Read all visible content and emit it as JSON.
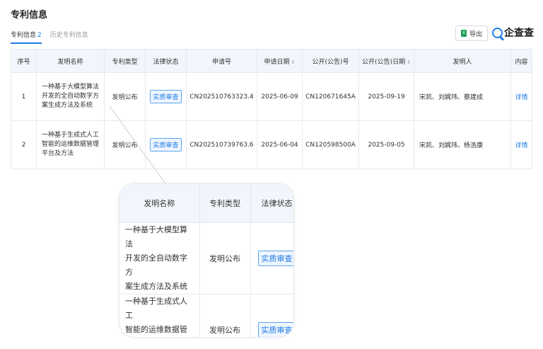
{
  "section_title": "专利信息",
  "tabs": [
    {
      "label": "专利信息",
      "count": "2",
      "active": true
    },
    {
      "label": "历史专利信息",
      "count": "",
      "active": false
    }
  ],
  "toolbar": {
    "export_label": "导出",
    "excel_icon": "excel-icon",
    "brand": "企查查"
  },
  "table": {
    "headers": {
      "index": "序号",
      "name": "发明名称",
      "type": "专利类型",
      "status": "法律状态",
      "app_no": "申请号",
      "app_date": "申请日期",
      "pub_no": "公开(公告)号",
      "pub_date": "公开(公告)日期",
      "inventors": "发明人",
      "content": "内容"
    },
    "sort_glyph": "⇕",
    "rows": [
      {
        "index": "1",
        "name": "一种基于大模型算法开发的全自动数字方案生成方法及系统",
        "name_lines": [
          "一种基于大模型算法",
          "开发的全自动数字方",
          "案生成方法及系统"
        ],
        "type": "发明公布",
        "status": "实质审查",
        "app_no": "CN202510763323.4",
        "app_date": "2025-06-09",
        "pub_no": "CN120671645A",
        "pub_date": "2025-09-19",
        "inventors": "宋凯、刘娓玮、蔡建成",
        "content": "详情"
      },
      {
        "index": "2",
        "name": "一种基于生成式人工智能的运维数据管理平台及方法",
        "name_lines": [
          "一种基于生成式人工",
          "智能的运维数据管理",
          "平台及方法"
        ],
        "type": "发明公布",
        "status": "实质审查",
        "app_no": "CN202510739763.6",
        "app_date": "2025-06-04",
        "pub_no": "CN120598500A",
        "pub_date": "2025-09-05",
        "inventors": "宋凯、刘娓玮、杨浩康",
        "content": "详情"
      }
    ]
  },
  "colors": {
    "accent": "#1e7be8",
    "header_bg": "#f2f6fc",
    "border": "#e6eaf0"
  }
}
